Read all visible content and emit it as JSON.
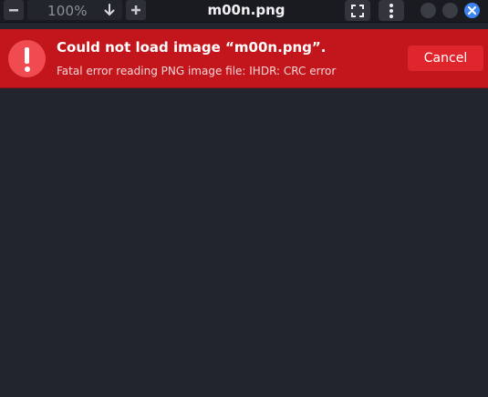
{
  "window": {
    "title": "m00n.png"
  },
  "toolbar": {
    "zoom_out_icon": "minus-icon",
    "zoom_value": "100%",
    "zoom_dropdown_icon": "arrow-down-icon",
    "zoom_in_icon": "plus-icon",
    "fullscreen_icon": "fullscreen-icon",
    "menu_icon": "vertical-dots-icon"
  },
  "error": {
    "icon": "exclamation-icon",
    "title": "Could not load image “m00n.png”.",
    "detail": "Fatal error reading PNG image file: IHDR: CRC error",
    "cancel_label": "Cancel",
    "color": "#c3161c",
    "button_color": "#e0262d"
  },
  "colors": {
    "background": "#23252e",
    "accent": "#3d84f2"
  }
}
